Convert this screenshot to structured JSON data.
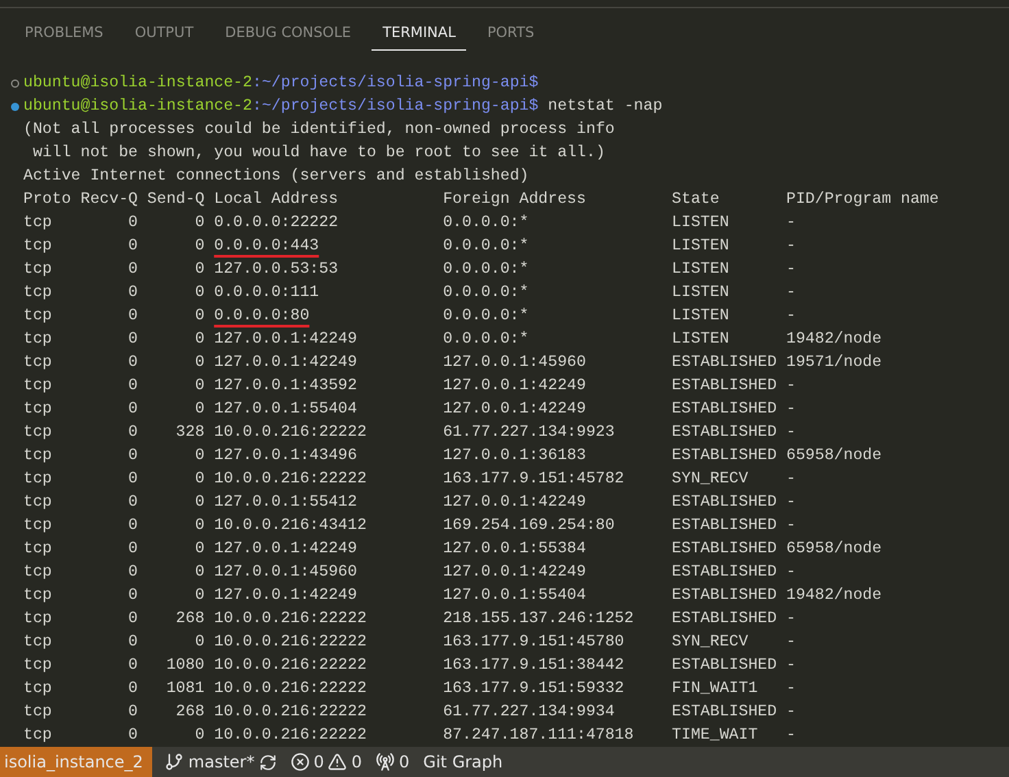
{
  "panel_tabs": [
    {
      "label": "PROBLEMS",
      "selected": false
    },
    {
      "label": "OUTPUT",
      "selected": false
    },
    {
      "label": "DEBUG CONSOLE",
      "selected": false
    },
    {
      "label": "TERMINAL",
      "selected": true
    },
    {
      "label": "PORTS",
      "selected": false
    }
  ],
  "terminal": {
    "prompts": [
      {
        "active": false,
        "user_host": "ubuntu@isolia-instance-2",
        "path": ":~/projects/isolia-spring-api$"
      },
      {
        "active": true,
        "user_host": "ubuntu@isolia-instance-2",
        "path": ":~/projects/isolia-spring-api$",
        "command": "netstat -nap"
      }
    ],
    "messages": [
      "(Not all processes could be identified, non-owned process info",
      " will not be shown, you would have to be root to see it all.)",
      "Active Internet connections (servers and established)"
    ],
    "columns": [
      "Proto",
      "Recv-Q",
      "Send-Q",
      "Local Address",
      "Foreign Address",
      "State",
      "PID/Program name"
    ],
    "rows": [
      {
        "proto": "tcp",
        "recv_q": "0",
        "send_q": "0",
        "local": "0.0.0.0:22222",
        "foreign": "0.0.0.0:*",
        "state": "LISTEN",
        "pid": "-",
        "underlined": false
      },
      {
        "proto": "tcp",
        "recv_q": "0",
        "send_q": "0",
        "local": "0.0.0.0:443",
        "foreign": "0.0.0.0:*",
        "state": "LISTEN",
        "pid": "-",
        "underlined": true
      },
      {
        "proto": "tcp",
        "recv_q": "0",
        "send_q": "0",
        "local": "127.0.0.53:53",
        "foreign": "0.0.0.0:*",
        "state": "LISTEN",
        "pid": "-",
        "underlined": false
      },
      {
        "proto": "tcp",
        "recv_q": "0",
        "send_q": "0",
        "local": "0.0.0.0:111",
        "foreign": "0.0.0.0:*",
        "state": "LISTEN",
        "pid": "-",
        "underlined": false
      },
      {
        "proto": "tcp",
        "recv_q": "0",
        "send_q": "0",
        "local": "0.0.0.0:80",
        "foreign": "0.0.0.0:*",
        "state": "LISTEN",
        "pid": "-",
        "underlined": true
      },
      {
        "proto": "tcp",
        "recv_q": "0",
        "send_q": "0",
        "local": "127.0.0.1:42249",
        "foreign": "0.0.0.0:*",
        "state": "LISTEN",
        "pid": "19482/node",
        "underlined": false
      },
      {
        "proto": "tcp",
        "recv_q": "0",
        "send_q": "0",
        "local": "127.0.0.1:42249",
        "foreign": "127.0.0.1:45960",
        "state": "ESTABLISHED",
        "pid": "19571/node",
        "underlined": false
      },
      {
        "proto": "tcp",
        "recv_q": "0",
        "send_q": "0",
        "local": "127.0.0.1:43592",
        "foreign": "127.0.0.1:42249",
        "state": "ESTABLISHED",
        "pid": "-",
        "underlined": false
      },
      {
        "proto": "tcp",
        "recv_q": "0",
        "send_q": "0",
        "local": "127.0.0.1:55404",
        "foreign": "127.0.0.1:42249",
        "state": "ESTABLISHED",
        "pid": "-",
        "underlined": false
      },
      {
        "proto": "tcp",
        "recv_q": "0",
        "send_q": "328",
        "local": "10.0.0.216:22222",
        "foreign": "61.77.227.134:9923",
        "state": "ESTABLISHED",
        "pid": "-",
        "underlined": false
      },
      {
        "proto": "tcp",
        "recv_q": "0",
        "send_q": "0",
        "local": "127.0.0.1:43496",
        "foreign": "127.0.0.1:36183",
        "state": "ESTABLISHED",
        "pid": "65958/node",
        "underlined": false
      },
      {
        "proto": "tcp",
        "recv_q": "0",
        "send_q": "0",
        "local": "10.0.0.216:22222",
        "foreign": "163.177.9.151:45782",
        "state": "SYN_RECV",
        "pid": "-",
        "underlined": false
      },
      {
        "proto": "tcp",
        "recv_q": "0",
        "send_q": "0",
        "local": "127.0.0.1:55412",
        "foreign": "127.0.0.1:42249",
        "state": "ESTABLISHED",
        "pid": "-",
        "underlined": false
      },
      {
        "proto": "tcp",
        "recv_q": "0",
        "send_q": "0",
        "local": "10.0.0.216:43412",
        "foreign": "169.254.169.254:80",
        "state": "ESTABLISHED",
        "pid": "-",
        "underlined": false
      },
      {
        "proto": "tcp",
        "recv_q": "0",
        "send_q": "0",
        "local": "127.0.0.1:42249",
        "foreign": "127.0.0.1:55384",
        "state": "ESTABLISHED",
        "pid": "65958/node",
        "underlined": false
      },
      {
        "proto": "tcp",
        "recv_q": "0",
        "send_q": "0",
        "local": "127.0.0.1:45960",
        "foreign": "127.0.0.1:42249",
        "state": "ESTABLISHED",
        "pid": "-",
        "underlined": false
      },
      {
        "proto": "tcp",
        "recv_q": "0",
        "send_q": "0",
        "local": "127.0.0.1:42249",
        "foreign": "127.0.0.1:55404",
        "state": "ESTABLISHED",
        "pid": "19482/node",
        "underlined": false
      },
      {
        "proto": "tcp",
        "recv_q": "0",
        "send_q": "268",
        "local": "10.0.0.216:22222",
        "foreign": "218.155.137.246:1252",
        "state": "ESTABLISHED",
        "pid": "-",
        "underlined": false
      },
      {
        "proto": "tcp",
        "recv_q": "0",
        "send_q": "0",
        "local": "10.0.0.216:22222",
        "foreign": "163.177.9.151:45780",
        "state": "SYN_RECV",
        "pid": "-",
        "underlined": false
      },
      {
        "proto": "tcp",
        "recv_q": "0",
        "send_q": "1080",
        "local": "10.0.0.216:22222",
        "foreign": "163.177.9.151:38442",
        "state": "ESTABLISHED",
        "pid": "-",
        "underlined": false
      },
      {
        "proto": "tcp",
        "recv_q": "0",
        "send_q": "1081",
        "local": "10.0.0.216:22222",
        "foreign": "163.177.9.151:59332",
        "state": "FIN_WAIT1",
        "pid": "-",
        "underlined": false
      },
      {
        "proto": "tcp",
        "recv_q": "0",
        "send_q": "268",
        "local": "10.0.0.216:22222",
        "foreign": "61.77.227.134:9934",
        "state": "ESTABLISHED",
        "pid": "-",
        "underlined": false
      },
      {
        "proto": "tcp",
        "recv_q": "0",
        "send_q": "0",
        "local": "10.0.0.216:22222",
        "foreign": "87.247.187.111:47818",
        "state": "TIME_WAIT",
        "pid": "-",
        "underlined": false
      }
    ]
  },
  "status_bar": {
    "remote": "isolia_instance_2",
    "branch": "master*",
    "errors": "0",
    "warnings": "0",
    "ports": "0",
    "git_graph": "Git Graph"
  }
}
